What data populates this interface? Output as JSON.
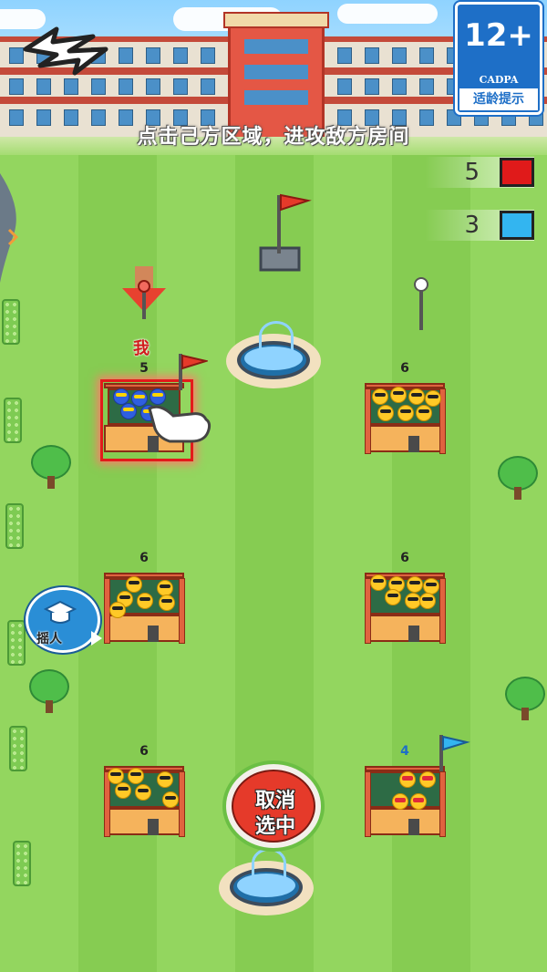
{
  "hint": "点击己方区域，进攻敌方房间",
  "age_badge": {
    "rating": "12+",
    "org": "CADPA",
    "tip": "适龄提示"
  },
  "scores": [
    {
      "value": "5",
      "color": "#e01a1a"
    },
    {
      "value": "3",
      "color": "#33b5f0"
    }
  ],
  "me_label": "我",
  "rooms": [
    {
      "count": "5",
      "owner": "player"
    },
    {
      "count": "6",
      "owner": "neutral"
    },
    {
      "count": "6",
      "owner": "neutral"
    },
    {
      "count": "6",
      "owner": "neutral"
    },
    {
      "count": "6",
      "owner": "neutral"
    },
    {
      "count": "4",
      "owner": "enemy"
    }
  ],
  "cancel_button": {
    "line1": "取消",
    "line2": "选中"
  },
  "recruit_button": {
    "label": "摇人"
  },
  "colors": {
    "player": "#e01a1a",
    "enemy": "#33b5f0",
    "grass_light": "#93d65f",
    "grass_dark": "#86cc52"
  },
  "icons": {
    "back": "lightning-back-icon",
    "recruit": "graduation-cap-icon",
    "hand": "tap-hand-icon"
  }
}
